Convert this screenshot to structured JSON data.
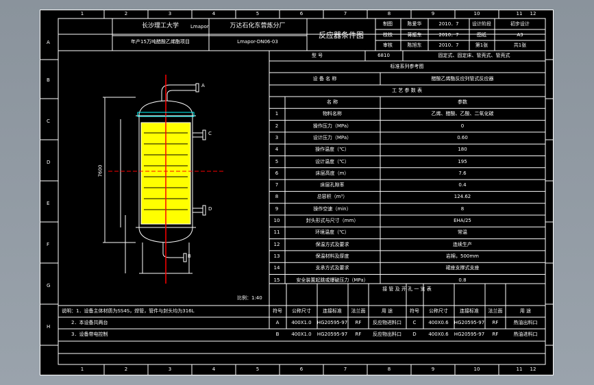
{
  "title_block": {
    "university": "长沙理工大学",
    "author": "Lmapor",
    "factory": "万达石化东营炼分厂",
    "project": "年产15万吨醋酸乙烯酯项目",
    "drawing_no": "Lmapor-DN06-03",
    "drawing_name": "反应器条件图",
    "rows": [
      {
        "role": "制图",
        "name": "陈爱华",
        "date": "2010．7",
        "label": "设计阶段",
        "value": "初步设计"
      },
      {
        "role": "校核",
        "name": "蒋振东",
        "date": "2010．7",
        "label": "图纸",
        "value": "A3"
      },
      {
        "role": "审核",
        "name": "陈旭东",
        "date": "2010．7",
        "label": "第1张",
        "value": "共1张"
      }
    ]
  },
  "spec": {
    "model_label": "型 号",
    "model_value": "6810",
    "type_text": "固定式、固定床、管壳式、管壳式",
    "std_header": "标准系列参考图",
    "equip_label": "设 备 名 称",
    "equip_value": "醋酸乙烯酯反应列管式反应器",
    "process_header": "工 艺 参 数 表",
    "col_item": "名 称",
    "col_value": "参数",
    "params": [
      {
        "no": "1",
        "name": "物料名称",
        "value": "乙烯、醋酸、乙酸、二氧化碳"
      },
      {
        "no": "2",
        "name": "操作压力（MPa）",
        "value": "0"
      },
      {
        "no": "3",
        "name": "设计压力（MPa）",
        "value": "0.60"
      },
      {
        "no": "4",
        "name": "操作温度（℃）",
        "value": "180"
      },
      {
        "no": "5",
        "name": "设计温度（℃）",
        "value": "195"
      },
      {
        "no": "6",
        "name": "床层高度（m）",
        "value": "7.6"
      },
      {
        "no": "7",
        "name": "床层孔隙率",
        "value": "0.4"
      },
      {
        "no": "8",
        "name": "总容积（m³）",
        "value": "124.62"
      },
      {
        "no": "9",
        "name": "操作空速（min）",
        "value": "8"
      },
      {
        "no": "10",
        "name": "封头形式与尺寸（mm）",
        "value": "EHA/25"
      },
      {
        "no": "11",
        "name": "环境温度（℃）",
        "value": "常温"
      },
      {
        "no": "12",
        "name": "保温方式及要求",
        "value": "连续生产"
      },
      {
        "no": "13",
        "name": "保温材料及厚度",
        "value": "岩棉，500mm"
      },
      {
        "no": "14",
        "name": "支承方式及要求",
        "value": "裙座支撑式支座"
      },
      {
        "no": "15",
        "name": "安全装置起跳或爆破压力（MPa）",
        "value": "0.8"
      }
    ]
  },
  "nozzle": {
    "header": "接 管 及 开 孔 一 览 表",
    "columns": [
      "符号",
      "公称尺寸",
      "连接标准",
      "法兰面",
      "用 途",
      "符号",
      "公称尺寸",
      "连接标准",
      "法兰面",
      "用 途"
    ],
    "rows": [
      [
        "A",
        "400Х1.0",
        "HG20595-97",
        "RF",
        "反应物进料口",
        "C",
        "400Х0.6",
        "HG20595-97",
        "RF",
        "热油出料口"
      ],
      [
        "B",
        "400Х1.0",
        "HG20595-97",
        "RF",
        "反应物出料口",
        "D",
        "400Х0.6",
        "HG20595-97",
        "RF",
        "热油进料口"
      ]
    ]
  },
  "notes": [
    "说明：1．设备主体材质为SS4S，焊管，管件与封头均为316L",
    "2．本设备共两台",
    "3．设备带电控制"
  ],
  "scale": "比例：1:40",
  "vessel_labels": {
    "a": "A",
    "b": "B",
    "c": "C",
    "d": "D",
    "height": "7600"
  },
  "border_cols": [
    "1",
    "2",
    "3",
    "4",
    "5",
    "6",
    "7",
    "8",
    "9",
    "10",
    "11",
    "12"
  ],
  "border_rows": [
    "A",
    "B",
    "C",
    "D",
    "E",
    "F",
    "G",
    "H"
  ],
  "colors": {
    "line": "#ffffff",
    "fill": "#ffff00",
    "accent": "#ff0000",
    "cyan": "#00ffff",
    "bg": "#9aa3ac"
  }
}
